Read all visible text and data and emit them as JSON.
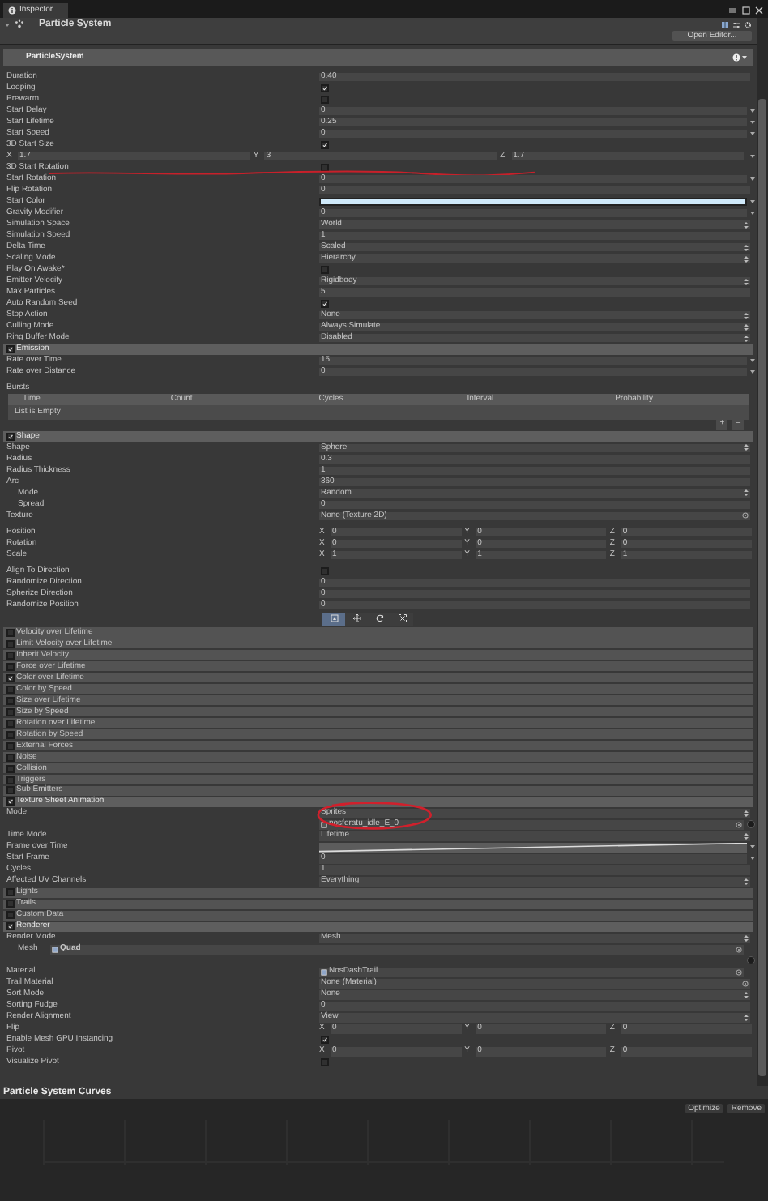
{
  "window": {
    "tab": "Inspector"
  },
  "component": {
    "title": "Particle System",
    "button": "Open Editor...",
    "expanded": true
  },
  "system_header": "ParticleSystem",
  "rows": [
    {
      "kind": "value",
      "label": "Duration",
      "value": "0.40"
    },
    {
      "kind": "toggle",
      "label": "Looping",
      "checked": true
    },
    {
      "kind": "toggle",
      "label": "Prewarm",
      "checked": false
    },
    {
      "kind": "minmax",
      "label": "Start Delay",
      "value": "0"
    },
    {
      "kind": "minmax",
      "label": "Start Lifetime",
      "value": "0.25"
    },
    {
      "kind": "minmax",
      "label": "Start Speed",
      "value": "0"
    },
    {
      "kind": "toggle",
      "label": "3D Start Size",
      "checked": true
    },
    {
      "kind": "vector_full",
      "axes": [
        {
          "axis": "X",
          "value": "1.7"
        },
        {
          "axis": "Y",
          "value": "3"
        },
        {
          "axis": "Z",
          "value": "1.7"
        }
      ]
    },
    {
      "kind": "toggle",
      "label": "3D Start Rotation",
      "checked": false,
      "underlined": true
    },
    {
      "kind": "minmax",
      "label": "Start Rotation",
      "value": "0"
    },
    {
      "kind": "value",
      "label": "Flip Rotation",
      "value": "0"
    },
    {
      "kind": "color",
      "label": "Start Color",
      "color": "#cfe9fa"
    },
    {
      "kind": "minmax",
      "label": "Gravity Modifier",
      "value": "0"
    },
    {
      "kind": "dropdown",
      "label": "Simulation Space",
      "value": "World"
    },
    {
      "kind": "value",
      "label": "Simulation Speed",
      "value": "1"
    },
    {
      "kind": "dropdown",
      "label": "Delta Time",
      "value": "Scaled"
    },
    {
      "kind": "dropdown",
      "label": "Scaling Mode",
      "value": "Hierarchy"
    },
    {
      "kind": "toggle",
      "label": "Play On Awake*",
      "checked": false
    },
    {
      "kind": "dropdown",
      "label": "Emitter Velocity",
      "value": "Rigidbody"
    },
    {
      "kind": "value",
      "label": "Max Particles",
      "value": "5"
    },
    {
      "kind": "toggle",
      "label": "Auto Random Seed",
      "checked": true
    },
    {
      "kind": "dropdown",
      "label": "Stop Action",
      "value": "None"
    },
    {
      "kind": "dropdown",
      "label": "Culling Mode",
      "value": "Always Simulate"
    },
    {
      "kind": "dropdown",
      "label": "Ring Buffer Mode",
      "value": "Disabled"
    },
    {
      "kind": "module",
      "label": "Emission",
      "checked": true,
      "expanded": true
    },
    {
      "kind": "minmax",
      "label": "Rate over Time",
      "value": "15"
    },
    {
      "kind": "minmax",
      "label": "Rate over Distance",
      "value": "0"
    },
    {
      "kind": "bursts",
      "label": "Bursts",
      "columns": [
        "Time",
        "Count",
        "Cycles",
        "Interval",
        "Probability"
      ],
      "empty": "List is Empty",
      "add": "+",
      "remove": "–"
    },
    {
      "kind": "module",
      "label": "Shape",
      "checked": true,
      "expanded": true
    },
    {
      "kind": "dropdown",
      "label": "Shape",
      "value": "Sphere"
    },
    {
      "kind": "value",
      "label": "Radius",
      "value": "0.3"
    },
    {
      "kind": "value",
      "label": "Radius Thickness",
      "value": "1"
    },
    {
      "kind": "value",
      "label": "Arc",
      "value": "360",
      "children": [
        {
          "kind": "dropdown",
          "label": "Mode",
          "value": "Random"
        },
        {
          "kind": "value",
          "label": "Spread",
          "value": "0"
        }
      ]
    },
    {
      "kind": "object",
      "label": "Texture",
      "value": "None (Texture 2D)"
    },
    {
      "kind": "vector",
      "label": "Position",
      "gap_before": true,
      "axes": [
        {
          "axis": "X",
          "value": "0"
        },
        {
          "axis": "Y",
          "value": "0"
        },
        {
          "axis": "Z",
          "value": "0"
        }
      ]
    },
    {
      "kind": "vector",
      "label": "Rotation",
      "axes": [
        {
          "axis": "X",
          "value": "0"
        },
        {
          "axis": "Y",
          "value": "0"
        },
        {
          "axis": "Z",
          "value": "0"
        }
      ]
    },
    {
      "kind": "vector",
      "label": "Scale",
      "axes": [
        {
          "axis": "X",
          "value": "1"
        },
        {
          "axis": "Y",
          "value": "1"
        },
        {
          "axis": "Z",
          "value": "1"
        }
      ]
    },
    {
      "kind": "toggle",
      "label": "Align To Direction",
      "checked": false,
      "gap_before": true
    },
    {
      "kind": "value",
      "label": "Randomize Direction",
      "value": "0"
    },
    {
      "kind": "value",
      "label": "Spherize Direction",
      "value": "0"
    },
    {
      "kind": "value",
      "label": "Randomize Position",
      "value": "0"
    },
    {
      "kind": "gizmos",
      "tools": [
        {
          "selected": true
        },
        {
          "selected": false
        },
        {
          "selected": false
        },
        {
          "selected": false
        }
      ]
    },
    {
      "kind": "module",
      "label": "Velocity over Lifetime",
      "checked": false,
      "expanded": false
    },
    {
      "kind": "module",
      "label": "Limit Velocity over Lifetime",
      "checked": false,
      "expanded": false
    },
    {
      "kind": "module",
      "label": "Inherit Velocity",
      "checked": false,
      "expanded": false
    },
    {
      "kind": "module",
      "label": "Force over Lifetime",
      "checked": false,
      "expanded": false
    },
    {
      "kind": "module",
      "label": "Color over Lifetime",
      "checked": true,
      "expanded": false
    },
    {
      "kind": "module",
      "label": "Color by Speed",
      "checked": false,
      "expanded": false
    },
    {
      "kind": "module",
      "label": "Size over Lifetime",
      "checked": false,
      "expanded": false
    },
    {
      "kind": "module",
      "label": "Size by Speed",
      "checked": false,
      "expanded": false
    },
    {
      "kind": "module",
      "label": "Rotation over Lifetime",
      "checked": false,
      "expanded": false
    },
    {
      "kind": "module",
      "label": "Rotation by Speed",
      "checked": false,
      "expanded": false
    },
    {
      "kind": "module",
      "label": "External Forces",
      "checked": false,
      "expanded": false
    },
    {
      "kind": "module",
      "label": "Noise",
      "checked": false,
      "expanded": false
    },
    {
      "kind": "module",
      "label": "Collision",
      "checked": false,
      "expanded": false
    },
    {
      "kind": "module",
      "label": "Triggers",
      "checked": false,
      "expanded": false
    },
    {
      "kind": "module",
      "label": "Sub Emitters",
      "checked": false,
      "expanded": false
    },
    {
      "kind": "module",
      "label": "Texture Sheet Animation",
      "checked": true,
      "expanded": true
    },
    {
      "kind": "dropdown",
      "label": "Mode",
      "value": "Sprites",
      "circled": true
    },
    {
      "kind": "sprite",
      "value": "nosferatu_idle_E_0"
    },
    {
      "kind": "dropdown",
      "label": "Time Mode",
      "value": "Lifetime"
    },
    {
      "kind": "curve",
      "label": "Frame over Time"
    },
    {
      "kind": "minmax",
      "label": "Start Frame",
      "value": "0"
    },
    {
      "kind": "value",
      "label": "Cycles",
      "value": "1"
    },
    {
      "kind": "dropdown",
      "label": "Affected UV Channels",
      "value": "Everything"
    },
    {
      "kind": "module",
      "label": "Lights",
      "checked": false,
      "expanded": false
    },
    {
      "kind": "module",
      "label": "Trails",
      "checked": false,
      "expanded": false
    },
    {
      "kind": "module",
      "label": "Custom Data",
      "checked": false,
      "expanded": false
    },
    {
      "kind": "module",
      "label": "Renderer",
      "checked": true,
      "expanded": true
    },
    {
      "kind": "dropdown",
      "label": "Render Mode",
      "value": "Mesh",
      "children": [
        {
          "kind": "mesh",
          "label": "Mesh",
          "value": "Quad"
        }
      ]
    },
    {
      "kind": "asset",
      "label": "Material",
      "value": "NosDashTrail"
    },
    {
      "kind": "object",
      "label": "Trail Material",
      "value": "None (Material)"
    },
    {
      "kind": "dropdown",
      "label": "Sort Mode",
      "value": "None"
    },
    {
      "kind": "value",
      "label": "Sorting Fudge",
      "value": "0"
    },
    {
      "kind": "dropdown",
      "label": "Render Alignment",
      "value": "View"
    },
    {
      "kind": "vector",
      "label": "Flip",
      "axes": [
        {
          "axis": "X",
          "value": "0"
        },
        {
          "axis": "Y",
          "value": "0"
        },
        {
          "axis": "Z",
          "value": "0"
        }
      ]
    },
    {
      "kind": "toggle",
      "label": "Enable Mesh GPU Instancing",
      "checked": true
    },
    {
      "kind": "vector",
      "label": "Pivot",
      "axes": [
        {
          "axis": "X",
          "value": "0"
        },
        {
          "axis": "Y",
          "value": "0"
        },
        {
          "axis": "Z",
          "value": "0"
        }
      ]
    },
    {
      "kind": "toggle",
      "label": "Visualize Pivot",
      "checked": false
    }
  ],
  "curves": {
    "title": "Particle System Curves",
    "buttons": [
      {
        "label": "Optimize",
        "disabled": true
      },
      {
        "label": "Remove",
        "disabled": true
      }
    ]
  }
}
